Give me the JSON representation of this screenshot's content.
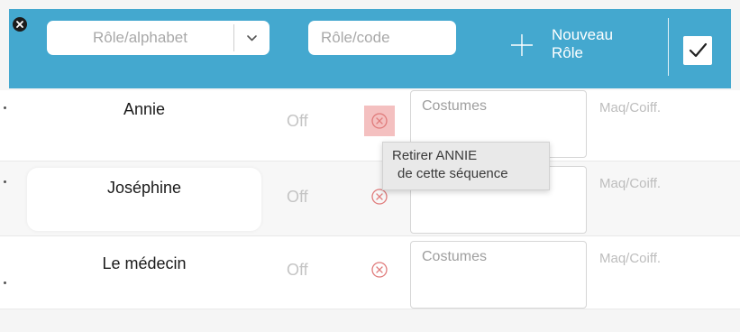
{
  "toolbar": {
    "role_sort_select": "Rôle/alphabet",
    "role_code_placeholder": "Rôle/code",
    "new_role_label_line1": "Nouveau",
    "new_role_label_line2": "Rôle",
    "accent_color": "#44a8cf"
  },
  "roles": [
    {
      "name": "Annie",
      "status": "Off",
      "costume_placeholder": "Costumes",
      "maq_label": "Maq/Coiff."
    },
    {
      "name": "Joséphine",
      "status": "Off",
      "costume_placeholder": "",
      "maq_label": "Maq/Coiff."
    },
    {
      "name": "Le médecin",
      "status": "Off",
      "costume_placeholder": "Costumes",
      "maq_label": "Maq/Coiff."
    }
  ],
  "tooltip": {
    "line1": "Retirer ANNIE",
    "line2": "de cette séquence"
  },
  "icons": {
    "close": "close-icon",
    "chevron": "chevron-down-icon",
    "plus": "plus-icon",
    "checkbox": "checkbox-checked-icon",
    "remove": "remove-circle-x-icon"
  }
}
